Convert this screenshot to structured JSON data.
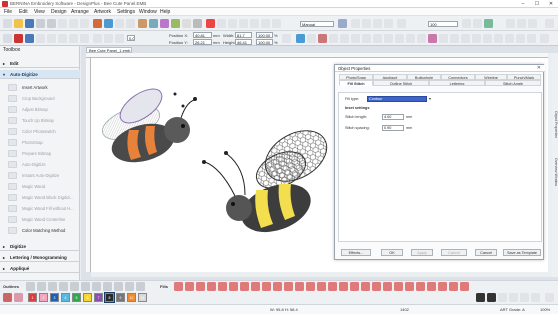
{
  "window": {
    "title": "BERNINA Embroidery Software - DesignPlus - Bee Cute Panel.EMB",
    "controls": [
      "–",
      "☐",
      "✕"
    ]
  },
  "menu": [
    "File",
    "Edit",
    "View",
    "Design",
    "Arrange",
    "Artwork",
    "Settings",
    "Window",
    "Help"
  ],
  "toolbar": {
    "style_value": "Fill",
    "hoop_value": "Manual",
    "zoom_value": "100",
    "position_x_label": "Position X:",
    "position_x_value": "40.81",
    "position_y_label": "Position Y:",
    "position_y_value": "26.21",
    "width_label": "Width:",
    "width_value": "81.7",
    "height_label": "Height:",
    "height_value": "46.41",
    "width_pct_value": "100.00",
    "height_pct_value": "100.00",
    "units": [
      "mm",
      "mm",
      "%",
      "%"
    ],
    "angle_value": "0.00"
  },
  "toolbox": {
    "title": "Toolbox",
    "groups": [
      {
        "label": "Edit",
        "expanded": false
      },
      {
        "label": "Auto-Digitize",
        "expanded": true,
        "tools": [
          {
            "label": "Insert Artwork",
            "enabled": true
          },
          {
            "label": "Crop Background",
            "enabled": false
          },
          {
            "label": "Adjust Bitmap",
            "enabled": false
          },
          {
            "label": "Touch Up Bitmap",
            "enabled": false
          },
          {
            "label": "Color Photoswitch",
            "enabled": false
          },
          {
            "label": "PhotoSnap",
            "enabled": false
          },
          {
            "label": "Prepare Bitmap",
            "enabled": false
          },
          {
            "label": "Auto-Digitize",
            "enabled": false
          },
          {
            "label": "Instant Auto-Digitize",
            "enabled": false
          },
          {
            "label": "Magic Wand",
            "enabled": false
          },
          {
            "label": "Magic Wand Block Digitizi...",
            "enabled": false
          },
          {
            "label": "Magic Wand Fill without H...",
            "enabled": false
          },
          {
            "label": "Magic Wand Centerline",
            "enabled": false
          },
          {
            "label": "Color Matching Method",
            "enabled": true
          }
        ]
      },
      {
        "label": "Digitize",
        "expanded": false
      },
      {
        "label": "Lettering / Monogramming",
        "expanded": false
      },
      {
        "label": "Appliqué",
        "expanded": false
      }
    ]
  },
  "document": {
    "tab_label": "Bee Cute Panel_1.emb"
  },
  "side_tabs": [
    "Object Properties",
    "Overview Window"
  ],
  "dialog": {
    "title": "Object Properties",
    "tabs_row1": [
      "Photo/Snap",
      "Appliqué",
      "Buttonhole",
      "Connectors",
      "Wireline",
      "Punch/Mark"
    ],
    "tabs_row2": [
      "Fill Stitch",
      "Outline Stitch",
      "Lettering",
      "Stitch Angle"
    ],
    "fill_type_label": "Fill type:",
    "fill_type_value": "Contour",
    "section_label": "Inset settings",
    "stitch_length_label": "Stitch length:",
    "stitch_length_value": "4.00",
    "stitch_spacing_label": "Stitch spacing:",
    "stitch_spacing_value": "0.90",
    "unit": "mm",
    "buttons": {
      "effects": "Effects...",
      "ok": "OK",
      "apply": "Apply",
      "cancel_dis": "Cancel",
      "cancel": "Cancel",
      "save": "Save as Template"
    }
  },
  "thread_bar": {
    "outlines_label": "Outlines",
    "fills_label": "Fills"
  },
  "palette": [
    {
      "label": "1",
      "color": "#e23b3b"
    },
    {
      "label": "2",
      "color": "#f2a6c0"
    },
    {
      "label": "3",
      "color": "#1f5fb0"
    },
    {
      "label": "4",
      "color": "#58b8e0"
    },
    {
      "label": "5",
      "color": "#2fa84f"
    },
    {
      "label": "6",
      "color": "#f5d631"
    },
    {
      "label": "7",
      "color": "#8a4fb0"
    },
    {
      "label": "8",
      "color": "#2a2a2a"
    },
    {
      "label": "9",
      "color": "#777777"
    },
    {
      "label": "10",
      "color": "#f08a2a"
    },
    {
      "label": "11",
      "color": "#d9d9d9"
    }
  ],
  "status": {
    "coords": "W: 95.8 H: 58.4",
    "stitches": "1402",
    "hoop": "ART Grade: A",
    "zoom": "100%"
  }
}
